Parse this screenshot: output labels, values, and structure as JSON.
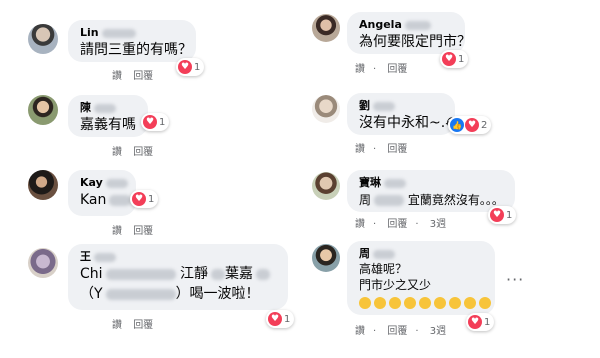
{
  "left_comments": [
    {
      "name": "Lin",
      "text": "請問三重的有嗎？",
      "reaction_count": "1",
      "actions": {
        "like": "讚",
        "reply": "回覆"
      }
    },
    {
      "name": "陳",
      "text": "嘉義有嗎",
      "reaction_count": "1",
      "actions": {
        "like": "讚",
        "reply": "回覆"
      }
    },
    {
      "name": "Kay",
      "text": "Kan",
      "reaction_count": "1",
      "actions": {
        "like": "讚",
        "reply": "回覆"
      }
    },
    {
      "name": "王",
      "text_line1_a": "Chi",
      "text_line1_b": "江靜",
      "text_line1_c": "葉嘉",
      "text_line2_a": "（Y",
      "text_line2_b": "）喝一波啦！",
      "reaction_count": "1",
      "actions": {
        "like": "讚",
        "reply": "回覆"
      }
    }
  ],
  "right_comments": [
    {
      "name": "Angela",
      "text": "為何要限定門市？",
      "reaction_count": "1",
      "actions": {
        "like": "讚",
        "reply": "回覆"
      }
    },
    {
      "name": "劉",
      "text": "沒有中永和~.",
      "text_emoji": "😭",
      "reaction_count": "2",
      "actions": {
        "like": "讚",
        "reply": "回覆"
      }
    },
    {
      "name": "寶琳",
      "text_a": "周",
      "text_b": "宜蘭竟然沒有。。。",
      "reaction_count": "1",
      "actions": {
        "like": "讚",
        "reply": "回覆",
        "time": "3週"
      }
    },
    {
      "name": "周",
      "text_line1": "高雄呢？",
      "text_line2": "門市少之又少",
      "emoji_row": "😔😔😔😔😔😔😔😔😔",
      "reaction_count": "1",
      "actions": {
        "like": "讚",
        "reply": "回覆",
        "time": "3週"
      },
      "more": "···"
    }
  ],
  "separator": "·",
  "colors": {
    "bubble": "#eff1f4",
    "heart": "#f33e58",
    "like": "#1877f2",
    "meta": "#65676b"
  }
}
